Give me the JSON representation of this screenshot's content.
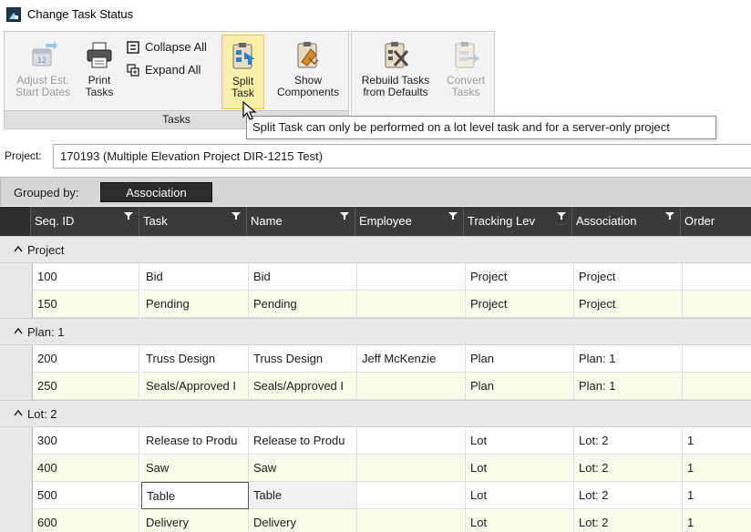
{
  "window": {
    "title": "Change Task Status"
  },
  "ribbon": {
    "group1_label": "Tasks",
    "adjust": {
      "label": "Adjust Est.\nStart Dates",
      "icon": "calendar-arrow-icon",
      "disabled": true
    },
    "print": {
      "label": "Print\nTasks",
      "icon": "printer-icon"
    },
    "collapse_all": {
      "label": "Collapse All",
      "icon": "collapse-all-icon"
    },
    "expand_all": {
      "label": "Expand All",
      "icon": "expand-all-icon"
    },
    "split": {
      "label": "Split\nTask",
      "icon": "clipboard-split-icon"
    },
    "show_components": {
      "label": "Show\nComponents",
      "icon": "clipboard-components-icon"
    },
    "rebuild": {
      "label": "Rebuild Tasks\nfrom Defaults",
      "icon": "clipboard-rebuild-icon"
    },
    "convert": {
      "label": "Convert\nTasks",
      "icon": "clipboard-convert-icon",
      "disabled": true
    }
  },
  "tooltip": "Split Task can only be performed on a lot level task and for a server-only project",
  "project": {
    "label": "Project:",
    "value": "170193 (Multiple Elevation Project DIR-1215 Test)"
  },
  "groupby": {
    "label": "Grouped by:",
    "chip": "Association"
  },
  "columns": [
    "Seq. ID",
    "Task",
    "Name",
    "Employee",
    "Tracking Lev",
    "Association",
    "Order"
  ],
  "groups": [
    {
      "label": "Project",
      "rows": [
        [
          "100",
          "Bid",
          "Bid",
          "",
          "Project",
          "Project",
          ""
        ],
        [
          "150",
          "Pending",
          "Pending",
          "",
          "Project",
          "Project",
          ""
        ]
      ]
    },
    {
      "label": "Plan: 1",
      "rows": [
        [
          "200",
          "Truss Design",
          "Truss Design",
          "Jeff McKenzie",
          "Plan",
          "Plan: 1",
          ""
        ],
        [
          "250",
          "Seals/Approved I",
          "Seals/Approved I",
          "",
          "Plan",
          "Plan: 1",
          ""
        ]
      ]
    },
    {
      "label": "Lot: 2",
      "rows": [
        [
          "300",
          "Release to Produ",
          "Release to Produ",
          "",
          "Lot",
          "Lot: 2",
          "1"
        ],
        [
          "400",
          "Saw",
          "Saw",
          "",
          "Lot",
          "Lot: 2",
          "1"
        ],
        [
          "500",
          "Table",
          "Table",
          "",
          "Lot",
          "Lot: 2",
          "1"
        ],
        [
          "600",
          "Delivery",
          "Delivery",
          "",
          "Lot",
          "Lot: 2",
          "1"
        ]
      ]
    }
  ]
}
